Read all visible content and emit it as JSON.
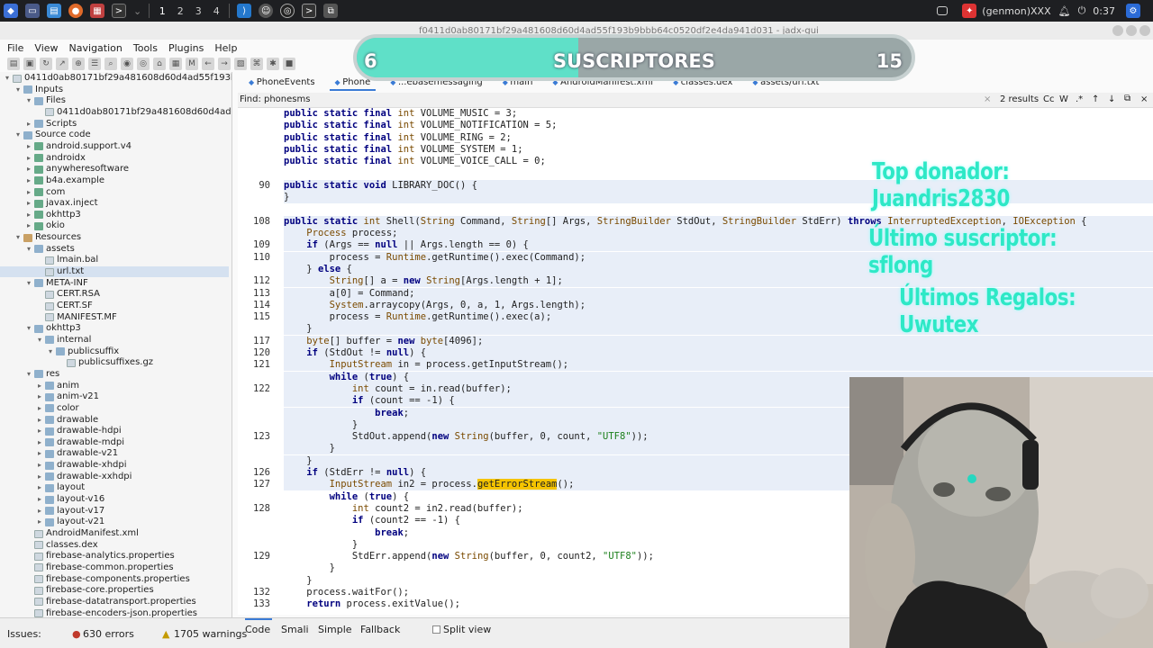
{
  "taskbar": {
    "workspaces": [
      "1",
      "2",
      "3",
      "4"
    ],
    "window_title": "f0411d0ab80171bf29a481608d60d4ad55f193b9bbb64c0520df2e4da941d031 - jadx-gui",
    "user_label": "(genmon)XXX",
    "clock": "0:37"
  },
  "menu": [
    "File",
    "View",
    "Navigation",
    "Tools",
    "Plugins",
    "Help"
  ],
  "tree": {
    "root": "0411d0ab80171bf29a481608d60d4ad55f193b9bbb64",
    "items": [
      {
        "label": "Inputs",
        "depth": 1,
        "kind": "folder",
        "open": true
      },
      {
        "label": "Files",
        "depth": 2,
        "kind": "folder",
        "open": true
      },
      {
        "label": "0411d0ab80171bf29a481608d60d4ad55f193b",
        "depth": 3,
        "kind": "file"
      },
      {
        "label": "Scripts",
        "depth": 2,
        "kind": "folder"
      },
      {
        "label": "Source code",
        "depth": 1,
        "kind": "folder",
        "open": true
      },
      {
        "label": "android.support.v4",
        "depth": 2,
        "kind": "pkg"
      },
      {
        "label": "androidx",
        "depth": 2,
        "kind": "pkg"
      },
      {
        "label": "anywheresoftware",
        "depth": 2,
        "kind": "pkg"
      },
      {
        "label": "b4a.example",
        "depth": 2,
        "kind": "pkg"
      },
      {
        "label": "com",
        "depth": 2,
        "kind": "pkg"
      },
      {
        "label": "javax.inject",
        "depth": 2,
        "kind": "pkg"
      },
      {
        "label": "okhttp3",
        "depth": 2,
        "kind": "pkg"
      },
      {
        "label": "okio",
        "depth": 2,
        "kind": "pkg"
      },
      {
        "label": "Resources",
        "depth": 1,
        "kind": "res",
        "open": true
      },
      {
        "label": "assets",
        "depth": 2,
        "kind": "folder",
        "open": true
      },
      {
        "label": "lmain.bal",
        "depth": 3,
        "kind": "file"
      },
      {
        "label": "url.txt",
        "depth": 3,
        "kind": "file",
        "selected": true
      },
      {
        "label": "META-INF",
        "depth": 2,
        "kind": "folder",
        "open": true
      },
      {
        "label": "CERT.RSA",
        "depth": 3,
        "kind": "file"
      },
      {
        "label": "CERT.SF",
        "depth": 3,
        "kind": "file"
      },
      {
        "label": "MANIFEST.MF",
        "depth": 3,
        "kind": "file"
      },
      {
        "label": "okhttp3",
        "depth": 2,
        "kind": "folder",
        "open": true
      },
      {
        "label": "internal",
        "depth": 3,
        "kind": "folder",
        "open": true
      },
      {
        "label": "publicsuffix",
        "depth": 4,
        "kind": "folder",
        "open": true
      },
      {
        "label": "publicsuffixes.gz",
        "depth": 5,
        "kind": "file"
      },
      {
        "label": "res",
        "depth": 2,
        "kind": "folder",
        "open": true
      },
      {
        "label": "anim",
        "depth": 3,
        "kind": "folder"
      },
      {
        "label": "anim-v21",
        "depth": 3,
        "kind": "folder"
      },
      {
        "label": "color",
        "depth": 3,
        "kind": "folder"
      },
      {
        "label": "drawable",
        "depth": 3,
        "kind": "folder"
      },
      {
        "label": "drawable-hdpi",
        "depth": 3,
        "kind": "folder"
      },
      {
        "label": "drawable-mdpi",
        "depth": 3,
        "kind": "folder"
      },
      {
        "label": "drawable-v21",
        "depth": 3,
        "kind": "folder"
      },
      {
        "label": "drawable-xhdpi",
        "depth": 3,
        "kind": "folder"
      },
      {
        "label": "drawable-xxhdpi",
        "depth": 3,
        "kind": "folder"
      },
      {
        "label": "layout",
        "depth": 3,
        "kind": "folder"
      },
      {
        "label": "layout-v16",
        "depth": 3,
        "kind": "folder"
      },
      {
        "label": "layout-v17",
        "depth": 3,
        "kind": "folder"
      },
      {
        "label": "layout-v21",
        "depth": 3,
        "kind": "folder"
      },
      {
        "label": "AndroidManifest.xml",
        "depth": 2,
        "kind": "file"
      },
      {
        "label": "classes.dex",
        "depth": 2,
        "kind": "file"
      },
      {
        "label": "firebase-analytics.properties",
        "depth": 2,
        "kind": "file"
      },
      {
        "label": "firebase-common.properties",
        "depth": 2,
        "kind": "file"
      },
      {
        "label": "firebase-components.properties",
        "depth": 2,
        "kind": "file"
      },
      {
        "label": "firebase-core.properties",
        "depth": 2,
        "kind": "file"
      },
      {
        "label": "firebase-datatransport.properties",
        "depth": 2,
        "kind": "file"
      },
      {
        "label": "firebase-encoders-json.properties",
        "depth": 2,
        "kind": "file"
      }
    ]
  },
  "tabs": [
    {
      "label": "PhoneEvents",
      "active": false
    },
    {
      "label": "Phone",
      "active": true
    },
    {
      "label": "...ebasemessaging",
      "active": false
    },
    {
      "label": "main",
      "active": false
    },
    {
      "label": "AndroidManifest.xml",
      "active": false
    },
    {
      "label": "classes.dex",
      "active": false
    },
    {
      "label": "assets/url.txt",
      "active": false
    }
  ],
  "find": {
    "label": "Find:",
    "value": "phonesms",
    "results": "2 results",
    "options": [
      "Cc",
      "W",
      ".*"
    ]
  },
  "code_lines": [
    {
      "ln": "",
      "html": "<span class='kw'>public static final</span> <span class='ty'>int</span> VOLUME_MUSIC = 3;",
      "hl": false
    },
    {
      "ln": "",
      "html": "<span class='kw'>public static final</span> <span class='ty'>int</span> VOLUME_NOTIFICATION = 5;",
      "hl": false
    },
    {
      "ln": "",
      "html": "<span class='kw'>public static final</span> <span class='ty'>int</span> VOLUME_RING = 2;",
      "hl": false
    },
    {
      "ln": "",
      "html": "<span class='kw'>public static final</span> <span class='ty'>int</span> VOLUME_SYSTEM = 1;",
      "hl": false
    },
    {
      "ln": "",
      "html": "<span class='kw'>public static final</span> <span class='ty'>int</span> VOLUME_VOICE_CALL = 0;",
      "hl": false
    },
    {
      "ln": "",
      "html": "",
      "hl": false
    },
    {
      "ln": "90",
      "html": "<span class='kw'>public static void</span> LIBRARY_DOC() {",
      "hl": true
    },
    {
      "ln": "",
      "html": "}",
      "hl": true
    },
    {
      "ln": "",
      "html": "",
      "hl": false
    },
    {
      "ln": "108",
      "html": "<span class='kw'>public static</span> <span class='ty'>int</span> Shell(<span class='ty'>String</span> Command, <span class='ty'>String</span>[] Args, <span class='ty'>StringBuilder</span> StdOut, <span class='ty'>StringBuilder</span> StdErr) <span class='kw'>throws</span> <span class='ty'>InterruptedException</span>, <span class='ty'>IOException</span> {",
      "hl": true
    },
    {
      "ln": "",
      "html": "    <span class='ty'>Process</span> process;",
      "hl": true
    },
    {
      "ln": "109",
      "html": "    <span class='kw'>if</span> (Args == <span class='kw'>null</span> || Args.length == 0) {",
      "hl": true
    },
    {
      "ln": "110",
      "html": "        process = <span class='ty'>Runtime</span>.getRuntime().exec(Command);",
      "hl": true
    },
    {
      "ln": "",
      "html": "    } <span class='kw'>else</span> {",
      "hl": true
    },
    {
      "ln": "112",
      "html": "        <span class='ty'>String</span>[] a = <span class='kw'>new</span> <span class='ty'>String</span>[Args.length + 1];",
      "hl": true
    },
    {
      "ln": "113",
      "html": "        a[0] = Command;",
      "hl": true
    },
    {
      "ln": "114",
      "html": "        <span class='ty'>System</span>.arraycopy(Args, 0, a, 1, Args.length);",
      "hl": true
    },
    {
      "ln": "115",
      "html": "        process = <span class='ty'>Runtime</span>.getRuntime().exec(a);",
      "hl": true
    },
    {
      "ln": "",
      "html": "    }",
      "hl": true
    },
    {
      "ln": "117",
      "html": "    <span class='ty'>byte</span>[] buffer = <span class='kw'>new</span> <span class='ty'>byte</span>[4096];",
      "hl": true
    },
    {
      "ln": "120",
      "html": "    <span class='kw'>if</span> (StdOut != <span class='kw'>null</span>) {",
      "hl": true
    },
    {
      "ln": "121",
      "html": "        <span class='ty'>InputStream</span> in = process.getInputStream();",
      "hl": true
    },
    {
      "ln": "",
      "html": "        <span class='kw'>while</span> (<span class='kw'>true</span>) {",
      "hl": true
    },
    {
      "ln": "122",
      "html": "            <span class='ty'>int</span> count = in.read(buffer);",
      "hl": true
    },
    {
      "ln": "",
      "html": "            <span class='kw'>if</span> (count == -1) {",
      "hl": true
    },
    {
      "ln": "",
      "html": "                <span class='kw'>break</span>;",
      "hl": true
    },
    {
      "ln": "",
      "html": "            }",
      "hl": true
    },
    {
      "ln": "123",
      "html": "            StdOut.append(<span class='kw'>new</span> <span class='ty'>String</span>(buffer, 0, count, <span class='st'>\"UTF8\"</span>));",
      "hl": true
    },
    {
      "ln": "",
      "html": "        }",
      "hl": true
    },
    {
      "ln": "",
      "html": "    }",
      "hl": true
    },
    {
      "ln": "126",
      "html": "    <span class='kw'>if</span> (StdErr != <span class='kw'>null</span>) {",
      "hl": true
    },
    {
      "ln": "127",
      "html": "        <span class='ty'>InputStream</span> in2 = process.<span class='find'>get</span><span class='find'>ErrorStream</span>();",
      "hl": true
    },
    {
      "ln": "",
      "html": "        <span class='kw'>while</span> (<span class='kw'>true</span>) {",
      "hl": false
    },
    {
      "ln": "128",
      "html": "            <span class='ty'>int</span> count2 = in2.read(buffer);",
      "hl": false
    },
    {
      "ln": "",
      "html": "            <span class='kw'>if</span> (count2 == -1) {",
      "hl": false
    },
    {
      "ln": "",
      "html": "                <span class='kw'>break</span>;",
      "hl": false
    },
    {
      "ln": "",
      "html": "            }",
      "hl": false
    },
    {
      "ln": "129",
      "html": "            StdErr.append(<span class='kw'>new</span> <span class='ty'>String</span>(buffer, 0, count2, <span class='st'>\"UTF8\"</span>));",
      "hl": false
    },
    {
      "ln": "",
      "html": "        }",
      "hl": false
    },
    {
      "ln": "",
      "html": "    }",
      "hl": false
    },
    {
      "ln": "132",
      "html": "    process.waitFor();",
      "hl": false
    },
    {
      "ln": "133",
      "html": "    <span class='kw'>return</span> process.exitValue();",
      "hl": false
    }
  ],
  "bottom": {
    "issues_label": "Issues:",
    "errors": "630 errors",
    "warnings": "1705 warnings",
    "views": [
      "Code",
      "Smali",
      "Simple",
      "Fallback"
    ],
    "split": "Split view"
  },
  "overlay": {
    "subs_left": "6",
    "subs_title": "SUSCRIPTORES",
    "subs_right": "15",
    "subs_progress": 0.4,
    "top_donor": "Top donador: Juandris2830",
    "last_sub": "Último suscriptor: sflong",
    "last_gifts": "Últimos Regalos: Uwutex"
  },
  "colors": {
    "accent_teal": "#2ee8c6",
    "find_highlight": "#f5c400",
    "keyword": "#00007f"
  }
}
